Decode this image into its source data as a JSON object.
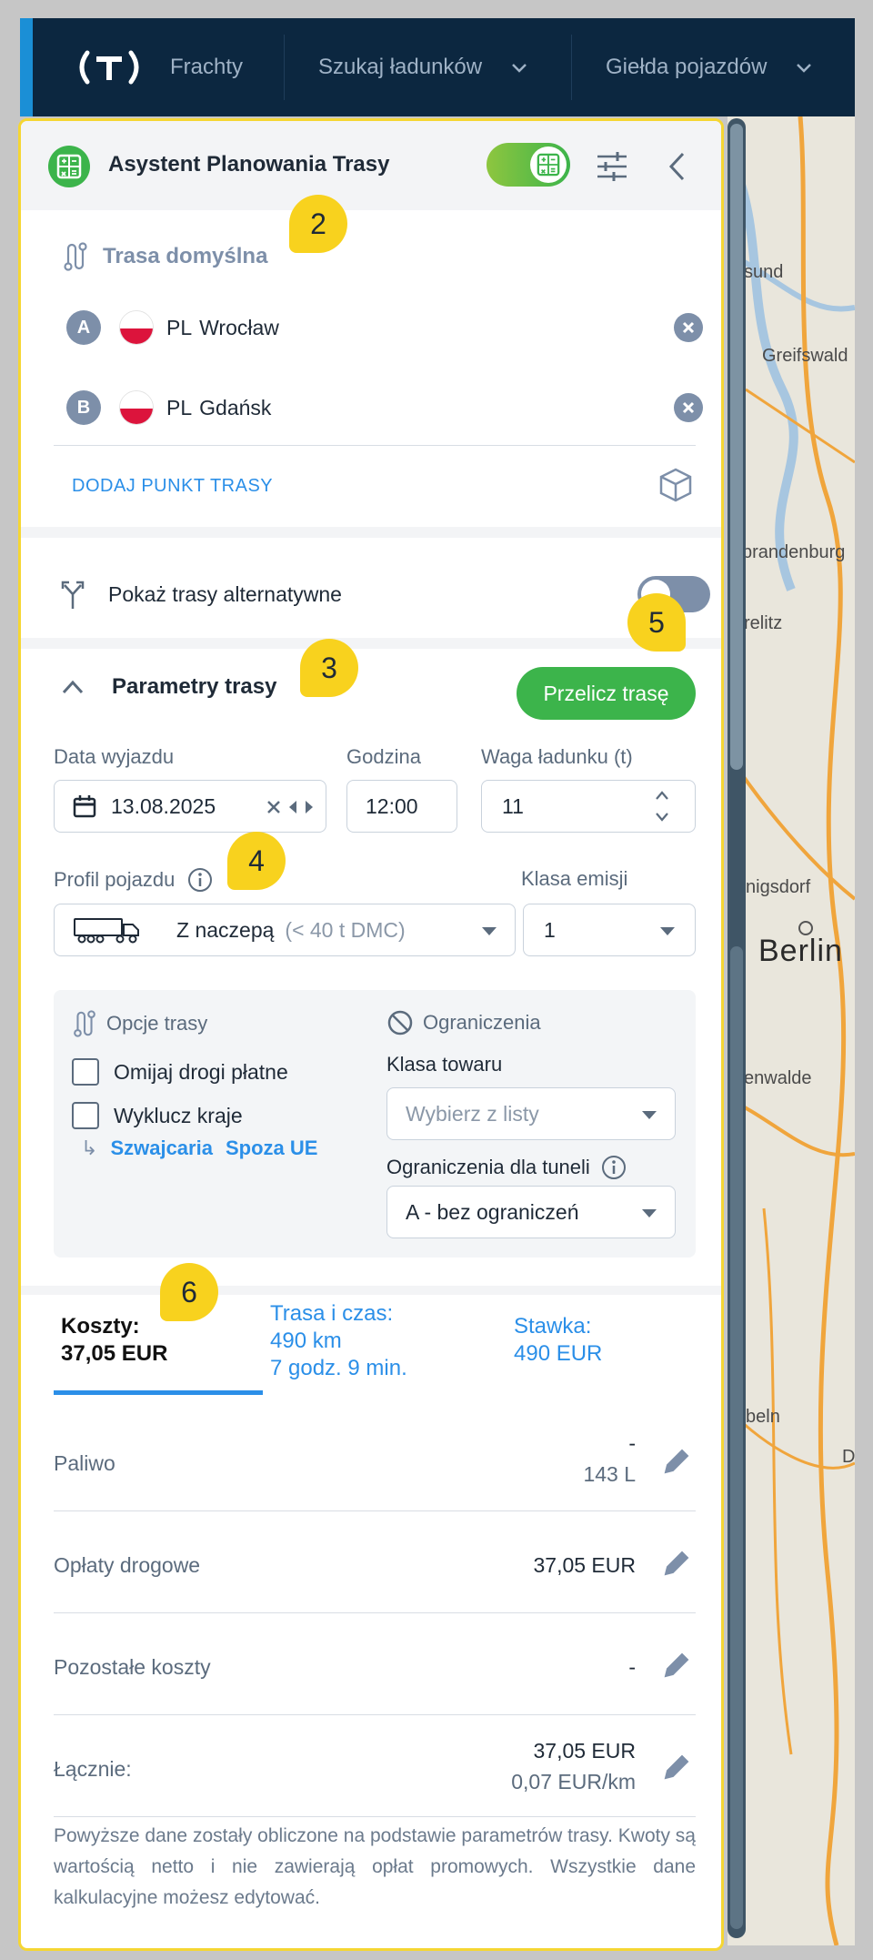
{
  "nav": {
    "items": [
      {
        "label": "Frachty"
      },
      {
        "label": "Szukaj ładunków"
      },
      {
        "label": "Giełda pojazdów"
      }
    ]
  },
  "map": {
    "labels": [
      "sund",
      "Greifswald",
      "brandenburg",
      "relitz",
      "nigsdorf",
      "Berlin",
      "enwalde",
      "beln",
      "D"
    ]
  },
  "panel": {
    "title": "Asystent Planowania Trasy",
    "route": {
      "title": "Trasa domyślna",
      "points": [
        {
          "letter": "A",
          "country": "PL",
          "city": "Wrocław"
        },
        {
          "letter": "B",
          "country": "PL",
          "city": "Gdańsk"
        }
      ],
      "add_point": "DODAJ PUNKT TRASY"
    },
    "alternatives": {
      "label": "Pokaż trasy alternatywne"
    },
    "params": {
      "title": "Parametry trasy",
      "recalc": "Przelicz trasę",
      "date_label": "Data wyjazdu",
      "date_value": "13.08.2025",
      "time_label": "Godzina",
      "time_value": "12:00",
      "weight_label": "Waga ładunku (t)",
      "weight_value": "11",
      "profile_label": "Profil pojazdu",
      "profile_value": "Z naczepą",
      "profile_hint": "(< 40 t DMC)",
      "emission_label": "Klasa emisji",
      "emission_value": "1"
    },
    "options": {
      "route_title": "Opcje trasy",
      "avoid_tolls": "Omijaj drogi płatne",
      "exclude_countries": "Wyklucz kraje",
      "countries": [
        "Szwajcaria",
        "Spoza UE"
      ],
      "restrictions_title": "Ograniczenia",
      "goods_class_label": "Klasa towaru",
      "goods_class_placeholder": "Wybierz z listy",
      "tunnel_label": "Ograniczenia dla tuneli",
      "tunnel_value": "A - bez ograniczeń"
    },
    "tabs": [
      {
        "line1": "Koszty:",
        "line2": "37,05 EUR"
      },
      {
        "line1": "Trasa i czas:",
        "line2": "490 km",
        "line3": "7 godz. 9 min."
      },
      {
        "line1": "Stawka:",
        "line2": "490 EUR"
      }
    ],
    "costs": [
      {
        "label": "Paliwo",
        "value": "-",
        "sub": "143 L"
      },
      {
        "label": "Opłaty drogowe",
        "value": "37,05 EUR"
      },
      {
        "label": "Pozostałe koszty",
        "value": "-"
      },
      {
        "label": "Łącznie:",
        "value": "37,05 EUR",
        "sub": "0,07 EUR/km"
      }
    ],
    "note": "Powyższe dane zostały obliczone na podstawie parametrów trasy. Kwoty są wartością netto i nie zawierają opłat promowych. Wszystkie dane kalkulacyjne możesz edytować."
  },
  "badges": [
    "2",
    "3",
    "4",
    "5",
    "6"
  ],
  "colors": {
    "accent_green": "#3cb44b",
    "link_blue": "#2b8fe8",
    "nav_bg": "#0c2740",
    "badge_yellow": "#f8d21e",
    "highlight_border": "#f5d633"
  }
}
